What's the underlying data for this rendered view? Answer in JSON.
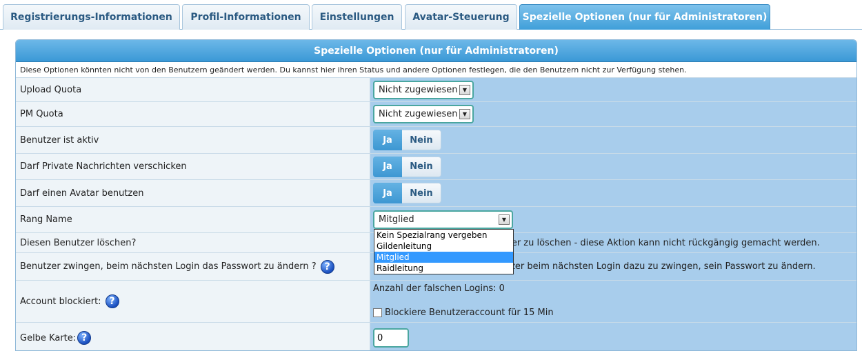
{
  "tabs": [
    {
      "label": "Registrierungs-Informationen"
    },
    {
      "label": "Profil-Informationen"
    },
    {
      "label": "Einstellungen"
    },
    {
      "label": "Avatar-Steuerung"
    },
    {
      "label": "Spezielle Optionen (nur für Administratoren)"
    }
  ],
  "panel": {
    "title": "Spezielle Optionen (nur für Administratoren)",
    "description": "Diese Optionen könnten nicht von den Benutzern geändert werden. Du kannst hier ihren Status und andere Optionen festlegen, die den Benutzern nicht zur Verfügung stehen."
  },
  "rows": {
    "upload_quota": {
      "label": "Upload Quota",
      "value": "Nicht zugewiesen"
    },
    "pm_quota": {
      "label": "PM Quota",
      "value": "Nicht zugewiesen"
    },
    "user_active": {
      "label": "Benutzer ist aktiv",
      "yes": "Ja",
      "no": "Nein"
    },
    "private_messages": {
      "label": "Darf Private Nachrichten verschicken",
      "yes": "Ja",
      "no": "Nein"
    },
    "avatar": {
      "label": "Darf einen Avatar benutzen",
      "yes": "Ja",
      "no": "Nein"
    },
    "rank": {
      "label": "Rang Name",
      "value": "Mitglied",
      "options": [
        "Kein Spezialrang vergeben",
        "Gildenleitung",
        "Mitglied",
        "Raidleitung"
      ]
    },
    "delete_user": {
      "label": "Diesen Benutzer löschen?",
      "text": "zer zu löschen - diese Aktion kann nicht rückgängig gemacht werden."
    },
    "force_password": {
      "label": "Benutzer zwingen, beim nächsten Login das Passwort zu ändern ?",
      "text": "tzer beim nächsten Login dazu zu zwingen, sein Passwort zu ändern."
    },
    "account_blocked": {
      "label": "Account blockiert:",
      "failed_logins": "Anzahl der falschen Logins: 0",
      "block_label": "Blockiere Benutzeraccount für 15 Min"
    },
    "yellow_card": {
      "label": "Gelbe Karte:",
      "value": "0"
    }
  },
  "icons": {
    "help": "?"
  }
}
